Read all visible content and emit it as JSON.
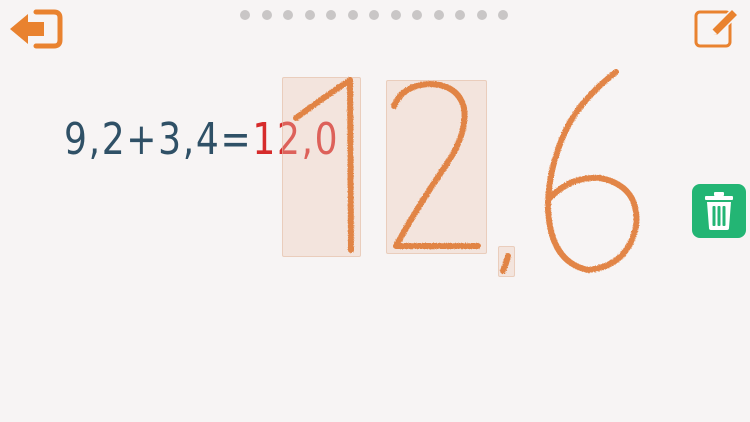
{
  "app": {
    "accent_color": "#e9822f",
    "problem_color": "#2f5066",
    "answer_color": "#d62b2b",
    "trash_color": "#23b574"
  },
  "toolbar": {
    "back_icon": "arrow-left-icon",
    "edit_icon": "pencil-edit-icon",
    "trash_icon": "trash-icon"
  },
  "pagination": {
    "total_pages": 13
  },
  "equation": {
    "problem": "9,2+3,4=",
    "answer": "12,0"
  },
  "handwriting": {
    "recognized_characters": [
      "1",
      "2",
      ",",
      "6"
    ]
  }
}
